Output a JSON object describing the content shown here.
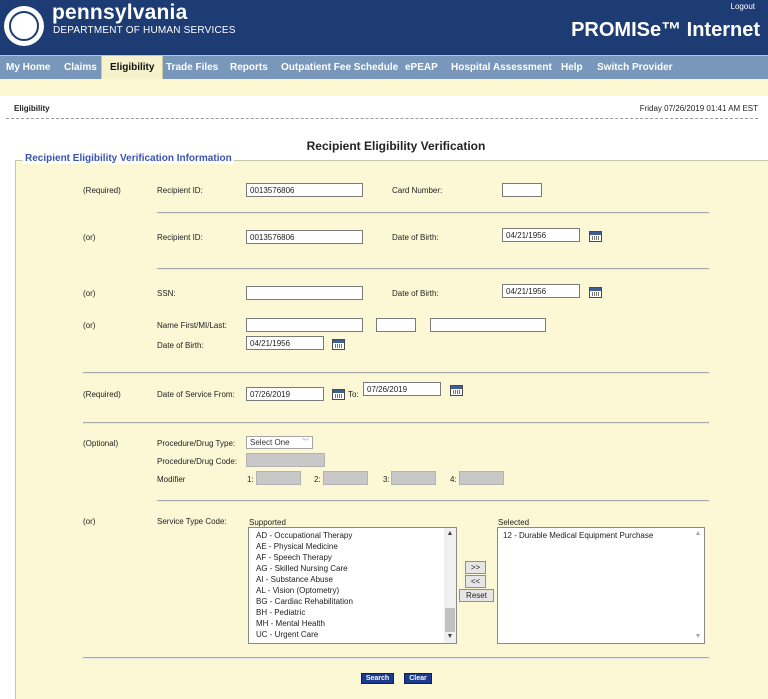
{
  "header": {
    "brand_name": "pennsylvania",
    "brand_sub": "DEPARTMENT OF HUMAN SERVICES",
    "logout": "Logout",
    "app_title": "PROMISe™ Internet"
  },
  "nav": {
    "items": [
      "My Home",
      "Claims",
      "Eligibility",
      "Trade Files",
      "Reports",
      "Outpatient Fee Schedule",
      "ePEAP",
      "Hospital Assessment",
      "Help",
      "Switch Provider"
    ],
    "active": "Eligibility"
  },
  "breadcrumb": "Eligibility",
  "datetime": "Friday 07/26/2019 01:41 AM EST",
  "page_title": "Recipient Eligibility Verification",
  "section_title": "Recipient Eligibility Verification Information",
  "form": {
    "row1": {
      "qualifier": "(Required)",
      "recipient_id_label": "Recipient ID:",
      "recipient_id": "0013576806",
      "card_number_label": "Card Number:",
      "card_number": ""
    },
    "row2": {
      "qualifier": "(or)",
      "recipient_id_label": "Recipient ID:",
      "recipient_id": "0013576806",
      "dob_label": "Date of Birth:",
      "dob": "04/21/1956"
    },
    "row3": {
      "qualifier": "(or)",
      "ssn_label": "SSN:",
      "ssn": "",
      "dob_label": "Date of Birth:",
      "dob": "04/21/1956"
    },
    "row4": {
      "qualifier": "(or)",
      "name_label": "Name First/MI/Last:",
      "first": "",
      "mi": "",
      "last": "",
      "dob_label": "Date of Birth:",
      "dob": "04/21/1956"
    },
    "row5": {
      "qualifier": "(Required)",
      "dos_from_label": "Date of Service From:",
      "dos_from": "07/26/2019",
      "to_label": "To:",
      "dos_to": "07/26/2019"
    },
    "row6": {
      "qualifier": "(Optional)",
      "proc_type_label": "Procedure/Drug Type:",
      "proc_type_value": "Select One",
      "proc_code_label": "Procedure/Drug Code:",
      "modifier_label": "Modifier",
      "mod_labels": [
        "1:",
        "2:",
        "3:",
        "4:"
      ]
    },
    "row7": {
      "qualifier": "(or)",
      "service_type_label": "Service Type Code:",
      "supported_label": "Supported",
      "selected_label": "Selected",
      "supported": [
        "AD - Occupational Therapy",
        "AE - Physical Medicine",
        "AF - Speech Therapy",
        "AG - Skilled Nursing Care",
        "AI - Substance Abuse",
        "AL - Vision (Optometry)",
        "BG - Cardiac Rehabilitation",
        "BH - Pediatric",
        "MH - Mental Health",
        "UC - Urgent Care"
      ],
      "selected": [
        "12 - Durable Medical Equipment Purchase"
      ],
      "add_button": ">>",
      "remove_button": "<<",
      "reset_button": "Reset"
    },
    "search_button": "Search",
    "clear_button": "Clear"
  },
  "colors": {
    "header_bg": "#1d3c73",
    "nav_bg": "#7897ba",
    "panel_bg": "#fcf8d5",
    "legend": "#3a55b0",
    "action_button": "#1a3a8f"
  }
}
